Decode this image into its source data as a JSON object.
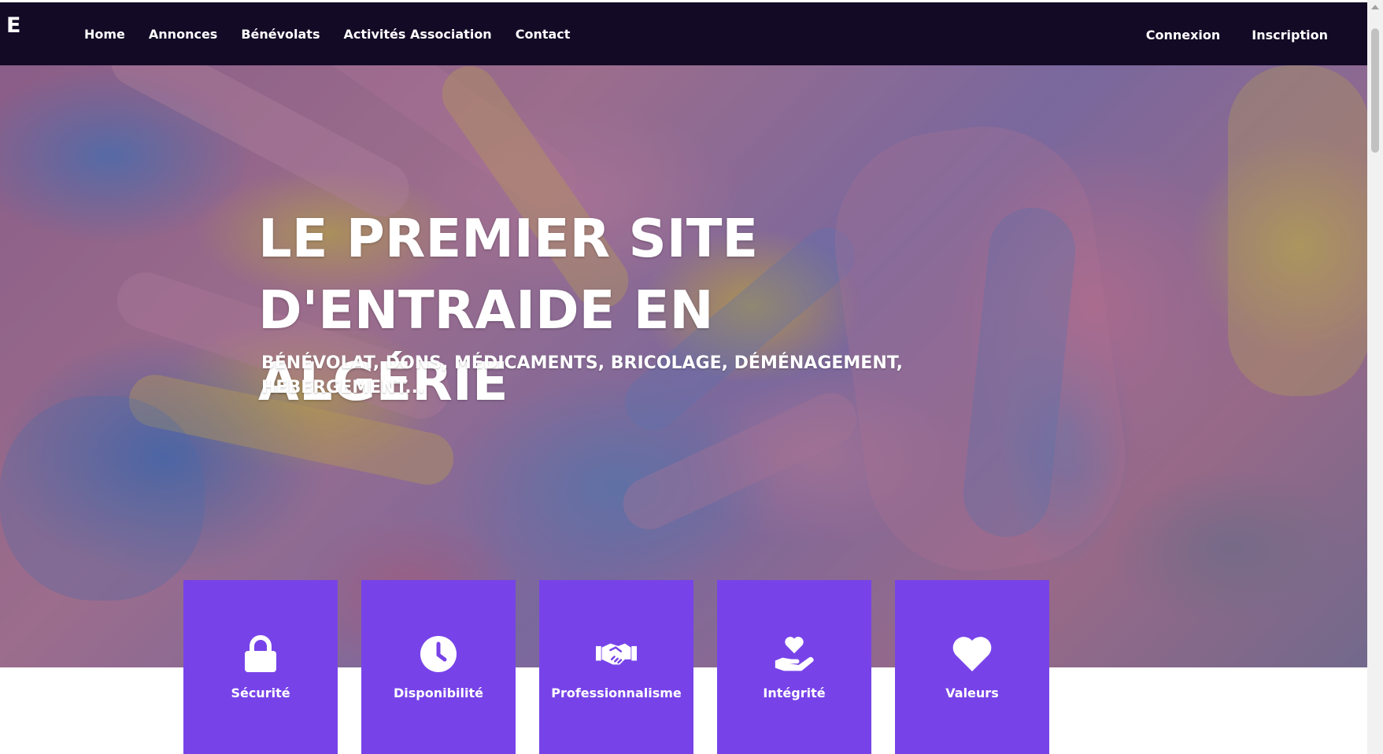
{
  "nav": {
    "logo": "E",
    "links": [
      {
        "label": "Home"
      },
      {
        "label": "Annonces"
      },
      {
        "label": "Bénévolats"
      },
      {
        "label": "Activités Association"
      },
      {
        "label": "Contact"
      }
    ],
    "auth": {
      "login": "Connexion",
      "register": "Inscription"
    }
  },
  "hero": {
    "title_line1": "LE PREMIER SITE",
    "title_line2": "D'ENTRAIDE EN ALGÉRIE",
    "subtitle_line1": "BÉNÉVOLAT, DONS, MÉDICAMENTS, BRICOLAGE, DÉMÉNAGEMENT,",
    "subtitle_line2": "HEBERGEMENT..."
  },
  "features": [
    {
      "label": "Sécurité",
      "icon": "lock-icon"
    },
    {
      "label": "Disponibilité",
      "icon": "clock-icon"
    },
    {
      "label": "Professionnalisme",
      "icon": "handshake-icon"
    },
    {
      "label": "Intégrité",
      "icon": "hand-heart-icon"
    },
    {
      "label": "Valeurs",
      "icon": "heart-icon"
    }
  ],
  "colors": {
    "navbar": "#130a26",
    "accent": "#7743e8"
  }
}
